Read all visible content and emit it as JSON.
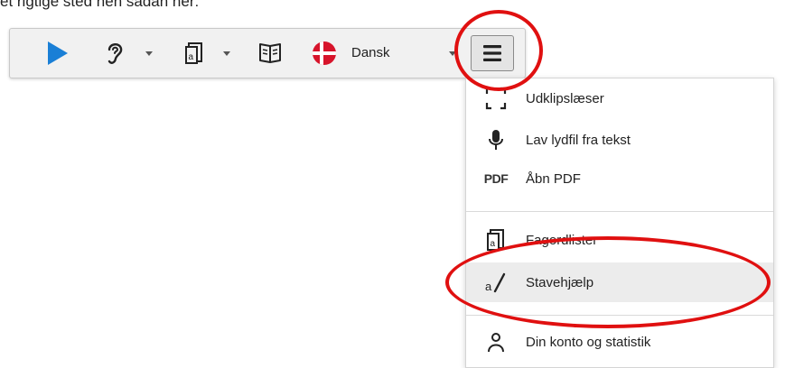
{
  "instruction_text": "et rigtige sted hen sådan her:",
  "toolbar": {
    "language_label": "Dansk",
    "icons": [
      "play-icon",
      "ear-icon",
      "word-list-icon",
      "open-book-icon",
      "danish-flag-icon",
      "hamburger-menu-icon"
    ]
  },
  "menu": {
    "items": [
      {
        "label": "Udklipslæser",
        "icon": "clipboard-reader-icon"
      },
      {
        "label": "Lav lydfil fra tekst",
        "icon": "microphone-icon"
      },
      {
        "label": "Åbn PDF",
        "icon": "pdf-icon",
        "icon_text": "PDF"
      },
      {
        "label": "Fagordlister",
        "icon": "word-list-icon"
      },
      {
        "label": "Stavehjælp",
        "icon": "spelling-help-icon",
        "icon_text": "a/"
      },
      {
        "label": "Din konto og statistik",
        "icon": "account-icon"
      }
    ]
  },
  "colors": {
    "play": "#1a7fd6",
    "annotation": "#e01010",
    "flag_red": "#d7142b"
  }
}
